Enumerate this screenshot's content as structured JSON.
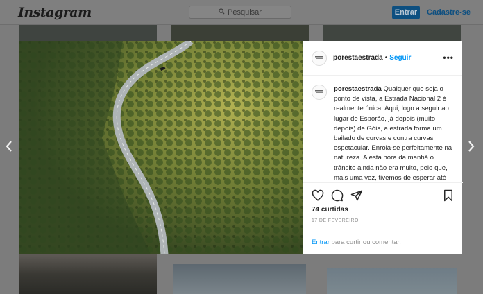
{
  "nav": {
    "logo": "Instagram",
    "search_placeholder": "Pesquisar",
    "login_label": "Entrar",
    "signup_label": "Cadastre-se"
  },
  "post": {
    "username": "porestaestrada",
    "separator": "•",
    "follow_label": "Seguir",
    "caption_username": "porestaestrada",
    "caption_text": "Qualquer que seja o ponto de vista, a Estrada Nacional 2 é realmente única. Aqui, logo a seguir ao lugar de Esporão, já depois (muito depois) de Góis, a estrada forma um bailado de curvas e contra curvas espetacular. Enrola-se perfeitamente na natureza. A esta hora da manhã o trânsito ainda não era muito, pelo que, mais uma vez, tivemos de esperar até aparecer um carro para oferecer",
    "likes": "74 curtidas",
    "date": "17 DE FEVEREIRO",
    "comment_login": "Entrar",
    "comment_prompt": " para curtir ou comentar."
  },
  "colors": {
    "accent": "#0095f6",
    "overlay": "#7c7c7c"
  },
  "icons": [
    "search-icon",
    "more-options-icon",
    "heart-icon",
    "comment-icon",
    "share-icon",
    "bookmark-icon",
    "prev-arrow-icon",
    "next-arrow-icon"
  ]
}
